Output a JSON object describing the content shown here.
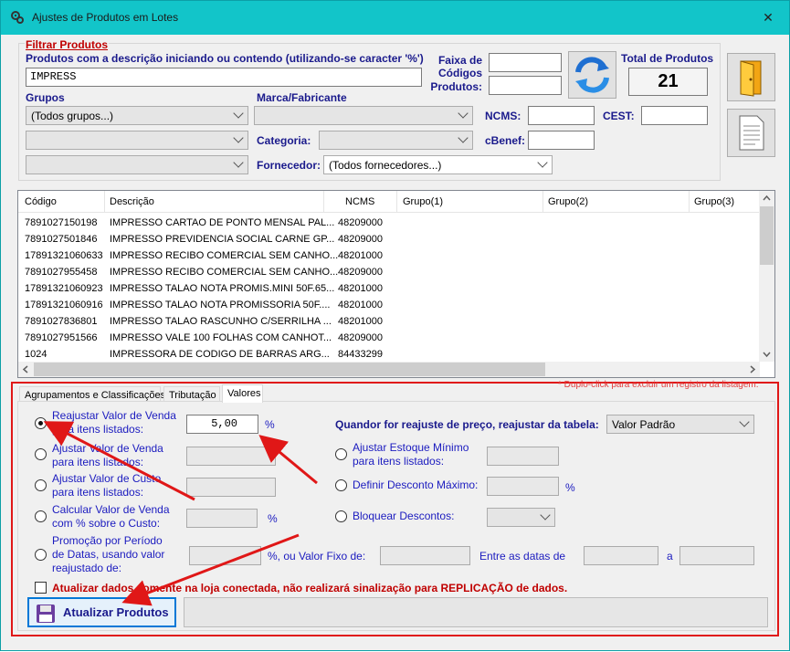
{
  "window": {
    "title": "Ajustes de Produtos em Lotes",
    "close_label": "✕"
  },
  "filter": {
    "section_title": "Filtrar Produtos",
    "desc_label": "Produtos com a descrição iniciando ou contendo (utilizando-se caracter '%')",
    "desc_value": "IMPRESS",
    "faixa_label": [
      "Faixa de",
      "Códigos",
      "Produtos:"
    ],
    "total_label": "Total de Produtos",
    "total_value": "21",
    "grupos_label": "Grupos",
    "grupos_value": "(Todos grupos...)",
    "marca_label": "Marca/Fabricante",
    "categoria_label": "Categoria:",
    "fornecedor_label": "Fornecedor:",
    "fornecedor_value": "(Todos fornecedores...)",
    "ncms_label": "NCMS:",
    "cest_label": "CEST:",
    "cbenef_label": "cBenef:"
  },
  "grid": {
    "columns": [
      "Código",
      "Descrição",
      "NCMS",
      "Grupo(1)",
      "Grupo(2)",
      "Grupo(3)"
    ],
    "rows": [
      [
        "7891027150198",
        "IMPRESSO CARTAO DE PONTO MENSAL PAL...",
        "48209000"
      ],
      [
        "7891027501846",
        "IMPRESSO PREVIDENCIA SOCIAL CARNE GP...",
        "48209000"
      ],
      [
        "17891321060633",
        "IMPRESSO RECIBO COMERCIAL SEM CANHO...",
        "48201000"
      ],
      [
        "7891027955458",
        "IMPRESSO RECIBO COMERCIAL SEM CANHO...",
        "48209000"
      ],
      [
        "17891321060923",
        "IMPRESSO TALAO NOTA PROMIS.MINI 50F.65...",
        "48201000"
      ],
      [
        "17891321060916",
        "IMPRESSO TALAO NOTA PROMISSORIA 50F....",
        "48201000"
      ],
      [
        "7891027836801",
        "IMPRESSO TALAO RASCUNHO C/SERRILHA ...",
        "48201000"
      ],
      [
        "7891027951566",
        "IMPRESSO VALE 100 FOLHAS COM CANHOT...",
        "48209000"
      ],
      [
        "1024",
        "IMPRESSORA DE CODIGO DE BARRAS ARG...",
        "84433299"
      ]
    ]
  },
  "tabs": {
    "t1": "Agrupamentos e Classificações",
    "t2": "Tributação",
    "t3": "Valores",
    "hint": "* Duplo-click para excluir um registro da listagem."
  },
  "valores": {
    "opt1": [
      "Reajustar Valor de Venda",
      "para itens listados:"
    ],
    "opt1_value": "5,00",
    "opt2": [
      "Ajustar Valor de Venda",
      "para itens listados:"
    ],
    "opt3": [
      "Ajustar Valor de Custo",
      "para itens listados:"
    ],
    "opt4": [
      "Calcular Valor de Venda",
      "com % sobre o Custo:"
    ],
    "opt5": [
      "Promoção por Período",
      "de Datas, usando valor",
      "reajustado de:"
    ],
    "pct": "%",
    "fixo_label": "%, ou Valor Fixo de:",
    "entre_label": "Entre as datas de",
    "a_label": "a",
    "tabela_label": "Quandor for reajuste de preço, reajustar da tabela:",
    "tabela_value": "Valor Padrão",
    "opt6": [
      "Ajustar Estoque Mínimo",
      "para itens listados:"
    ],
    "opt7": "Definir Desconto Máximo:",
    "opt8": "Bloquear Descontos:",
    "check_label": "Atualizar dados somente na loja conectada, não realizará sinalização para REPLICAÇÃO de dados.",
    "update_button": "Atualizar Produtos"
  },
  "colors": {
    "titlebar": "#12c5c9",
    "highlight_red": "#e01717",
    "label_blue": "#1a1a8c"
  }
}
